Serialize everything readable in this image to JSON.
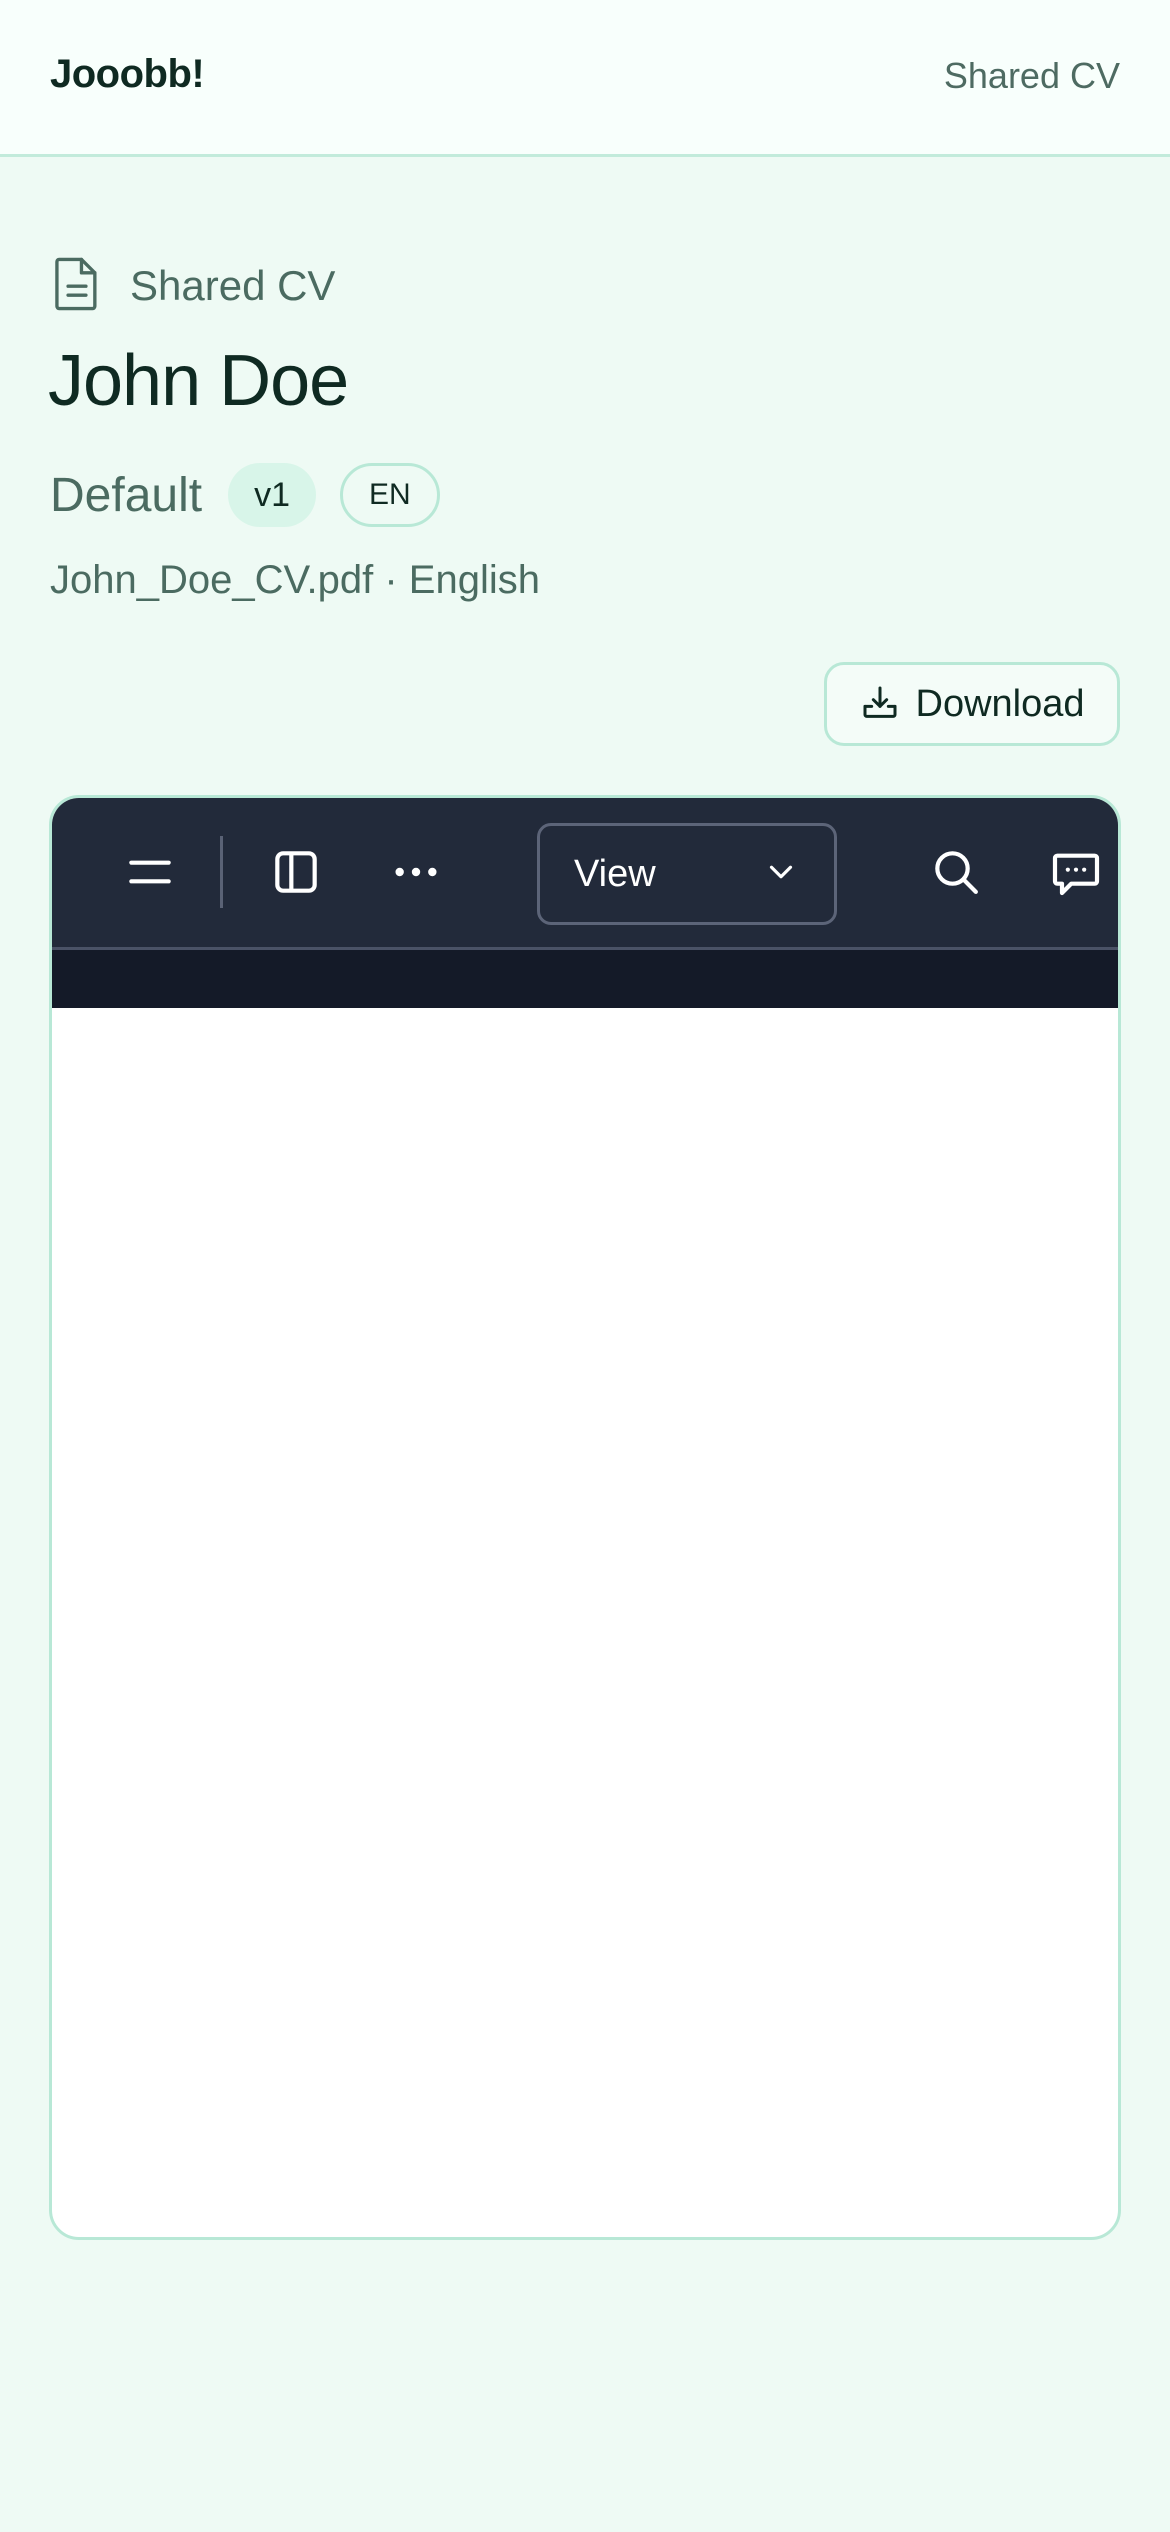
{
  "header": {
    "brand": "Jooobb!",
    "nav_label": "Shared CV"
  },
  "cv": {
    "eyebrow_icon": "document-icon",
    "eyebrow_label": "Shared CV",
    "name": "John Doe",
    "variant": "Default",
    "version": "v1",
    "language_code": "EN",
    "file_info": "John_Doe_CV.pdf · English",
    "download_label": "Download"
  },
  "viewer": {
    "toolbar": {
      "view_select_value": "View",
      "icons": [
        "menu-icon",
        "sidebar-toggle-icon",
        "more-icon",
        "chevron-down-icon",
        "search-icon",
        "comment-icon"
      ]
    }
  },
  "colors": {
    "page_background": "#eefaf4",
    "header_background": "#f8fffc",
    "accent_border": "#b8e8d6",
    "pill_background": "#d8f5e9",
    "viewer_toolbar": "#222a3a",
    "viewer_strip": "#141a28",
    "text_primary": "#0f2a22",
    "text_muted": "#4b6b61"
  }
}
